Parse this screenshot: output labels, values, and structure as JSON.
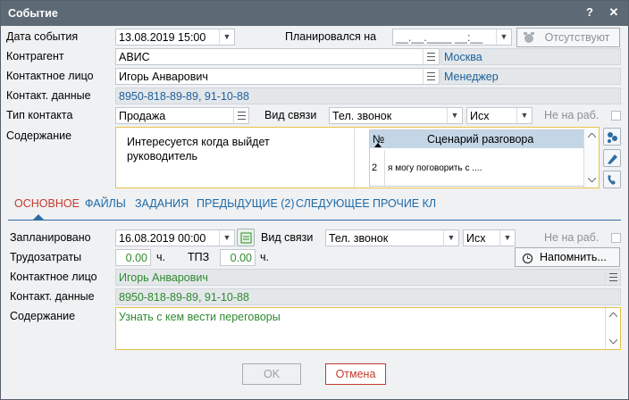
{
  "window": {
    "title": "Событие",
    "help": "?",
    "close": "✕"
  },
  "top": {
    "date_label": "Дата события",
    "date_value": "13.08.2019 15:00",
    "planned_label": "Планировался на",
    "planned_value": "__.__.____ __:__",
    "absent_label": "Отсутствуют",
    "counterparty_label": "Контрагент",
    "counterparty_value": "АВИС",
    "city_value": "Москва",
    "contact_label": "Контактное лицо",
    "contact_value": "Игорь Анварович",
    "position_value": "Менеджер",
    "contact_data_label": "Контакт. данные",
    "contact_data_value": "8950-818-89-89, 91-10-88",
    "contact_type_label": "Тип контакта",
    "contact_type_value": "Продажа",
    "comm_label": "Вид связи",
    "comm_value": "Тел. звонок",
    "direction_value": "Исх",
    "not_working_label": "Не на раб.",
    "content_label": "Содержание",
    "content_text": "Интересуется когда выйдет руководитель",
    "script_col_num": "№",
    "script_col_name": "Сценарий разговора",
    "script_rows": [
      {
        "num": "2",
        "text": "я могу поговорить с ...."
      }
    ]
  },
  "tabs": [
    {
      "label": "ОСНОВНОЕ"
    },
    {
      "label": "ФАЙЛЫ"
    },
    {
      "label": "ЗАДАНИЯ"
    },
    {
      "label": "ПРЕДЫДУЩИЕ (2)"
    },
    {
      "label": "СЛЕДУЮЩЕЕ"
    },
    {
      "label": "ПРОЧИЕ КЛ"
    }
  ],
  "main": {
    "planned_label": "Запланировано",
    "planned_value": "16.08.2019 00:00",
    "comm_label": "Вид связи",
    "comm_value": "Тел. звонок",
    "direction_value": "Исх",
    "not_working_label": "Не на раб.",
    "labor_label": "Трудозатраты",
    "labor_value": "0.00",
    "hours_unit": "ч.",
    "tpz_label": "ТПЗ",
    "tpz_value": "0.00",
    "hours_unit2": "ч.",
    "remind_label": "Напомнить...",
    "contact_label": "Контактное лицо",
    "contact_value": "Игорь Анварович",
    "contact_data_label": "Контакт. данные",
    "contact_data_value": "8950-818-89-89, 91-10-88",
    "content_label": "Содержание",
    "content_text": "Узнать с кем вести переговоры"
  },
  "footer": {
    "ok_label": "OK",
    "cancel_label": "Отмена"
  },
  "colors": {
    "titlebar": "#5d6975",
    "tab_active": "#c43b2a",
    "tab_link": "#1d6aa8",
    "highlight_border": "#e8c24a"
  }
}
